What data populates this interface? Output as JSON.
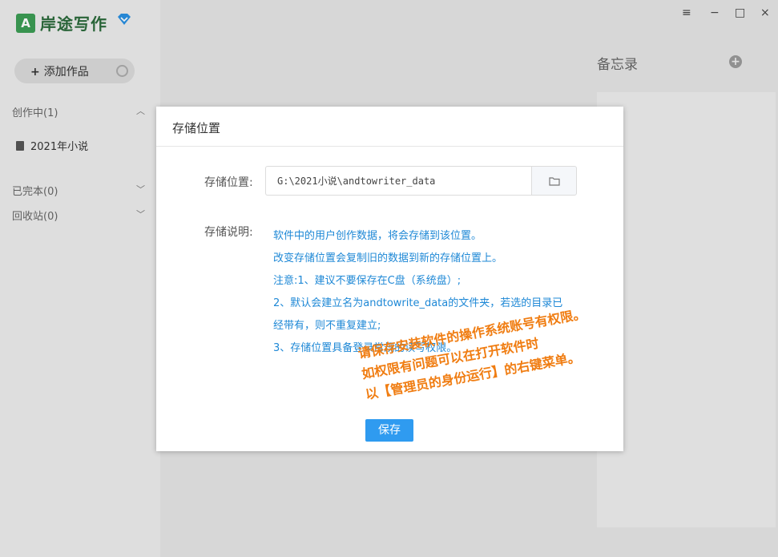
{
  "app": {
    "title": "岸途写作",
    "logo_mark": "A"
  },
  "sidebar": {
    "add_button_label": "添加作品",
    "sections": [
      {
        "label": "创作中(1)",
        "expanded": true
      },
      {
        "label": "已完本(0)",
        "expanded": false
      },
      {
        "label": "回收站(0)",
        "expanded": false
      }
    ],
    "books": [
      {
        "label": "2021年小说"
      }
    ]
  },
  "window": {
    "controls": [
      "≡",
      "−",
      "□",
      "×"
    ]
  },
  "memo": {
    "title": "备忘录"
  },
  "dialog": {
    "title": "存储位置",
    "path_label": "存储位置:",
    "path_value": "G:\\2021小说\\andtowriter_data",
    "desc_label": "存储说明:",
    "desc_lines": [
      "软件中的用户创作数据，将会存储到该位置。",
      "改变存储位置会复制旧的数据到新的存储位置上。",
      "注意:1、建议不要保存在C盘（系统盘）;",
      "2、默认会建立名为andtowrite_data的文件夹，若选的目录已",
      "经带有，则不重复建立;",
      "3、存储位置具备登录常规的读写权限。"
    ],
    "annotation_lines": [
      "请保存安装软件的操作系统账号有权限。",
      "如权限有问题可以在打开软件时",
      "以【管理员的身份运行】的右键菜单。"
    ],
    "save_label": "保存"
  },
  "colors": {
    "accent": "#2f9bf0",
    "desc_text": "#1e88d6",
    "annotation": "#f07d12",
    "brand": "#3c9b54"
  }
}
